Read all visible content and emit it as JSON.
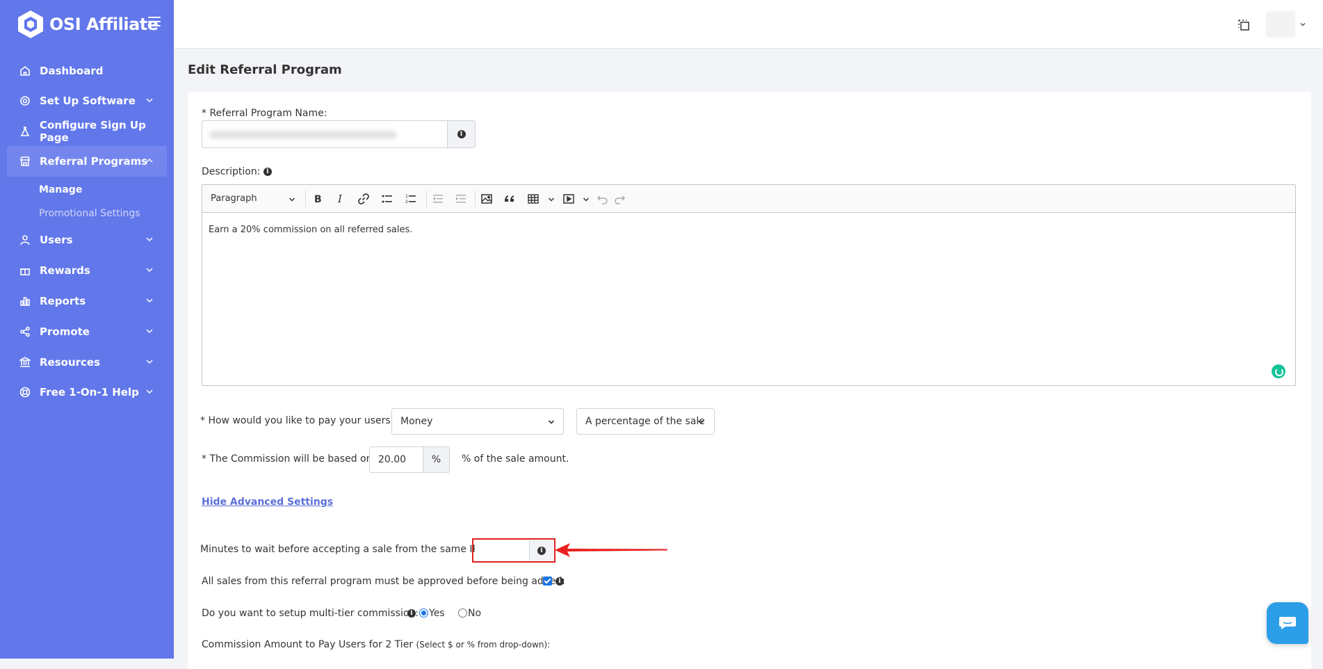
{
  "app": {
    "name": "OSI Affiliate"
  },
  "sidebar": {
    "items": [
      {
        "label": "Dashboard",
        "icon": "home-icon"
      },
      {
        "label": "Set Up Software",
        "icon": "gear-icon"
      },
      {
        "label": "Configure Sign Up Page",
        "icon": "flask-icon"
      },
      {
        "label": "Referral Programs",
        "icon": "store-icon",
        "active": true
      },
      {
        "label": "Users",
        "icon": "user-icon"
      },
      {
        "label": "Rewards",
        "icon": "gift-icon"
      },
      {
        "label": "Reports",
        "icon": "bar-chart-icon"
      },
      {
        "label": "Promote",
        "icon": "share-icon"
      },
      {
        "label": "Resources",
        "icon": "bank-icon"
      },
      {
        "label": "Free 1-On-1 Help",
        "icon": "lifebuoy-icon"
      }
    ],
    "subitems": [
      {
        "label": "Manage",
        "active": true
      },
      {
        "label": "Promotional Settings"
      }
    ]
  },
  "page": {
    "title": "Edit Referral Program"
  },
  "form": {
    "program_name_label": "* Referral Program Name:",
    "description_label": "Description:",
    "editor": {
      "paragraph_label": "Paragraph",
      "content": "Earn a 20% commission on all referred sales."
    },
    "pay_label": "* How would you like to pay your users:",
    "pay_type": "Money",
    "pay_basis": "A percentage of the sale",
    "commission_label": "* The Commission will be based on",
    "commission_value": "20.00",
    "commission_unit": "%",
    "commission_suffix": "% of the sale amount.",
    "advanced_link": "Hide Advanced Settings",
    "ip_wait_label": "Minutes to wait before accepting a sale from the same IP:",
    "ip_wait_value": "",
    "approval_label": "All sales from this referral program must be approved before being added:",
    "approval_checked": true,
    "multitier_label": "Do you want to setup multi-tier commission:",
    "multitier_yes": "Yes",
    "multitier_no": "No",
    "multitier_selected": "Yes",
    "tier2_label": "Commission Amount to Pay Users for 2 Tier",
    "tier2_hint": "(Select $ or % from drop-down):"
  },
  "colors": {
    "sidebar": "#6177ea",
    "accent": "#1a73e8",
    "highlight": "#e02020"
  }
}
